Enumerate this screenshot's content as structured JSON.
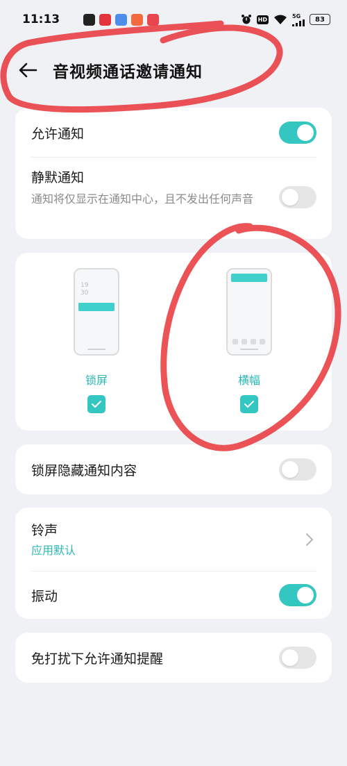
{
  "status_bar": {
    "time": "11:13",
    "network_label": "5G",
    "battery_level": "83",
    "notification_icon_colors": [
      "#222222",
      "#e2343a",
      "#4e8ee8",
      "#f26a3d",
      "#e8454f"
    ]
  },
  "header": {
    "title": "音视频通话邀请通知"
  },
  "allow_section": {
    "allow_label": "允许通知",
    "allow_enabled": true,
    "silent_label": "静默通知",
    "silent_desc": "通知将仅显示在通知中心，且不发出任何声音",
    "silent_enabled": false
  },
  "style_section": {
    "lockscreen": {
      "label": "锁屏",
      "clock_hour": "19",
      "clock_min": "30",
      "checked": true
    },
    "banner": {
      "label": "横幅",
      "checked": true
    }
  },
  "hide_content": {
    "label": "锁屏隐藏通知内容",
    "enabled": false
  },
  "sound_section": {
    "ringtone_label": "铃声",
    "ringtone_value": "应用默认",
    "vibrate_label": "振动",
    "vibrate_enabled": true
  },
  "dnd": {
    "label": "免打扰下允许通知提醒",
    "enabled": false
  },
  "colors": {
    "accent": "#34c6c1",
    "annotation_red": "#e8353a"
  }
}
